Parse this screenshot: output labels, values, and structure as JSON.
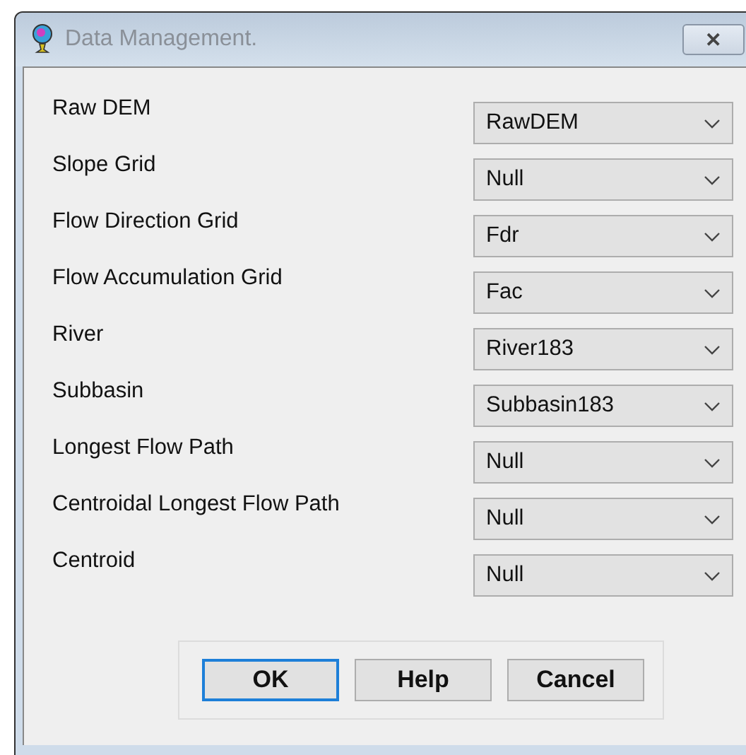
{
  "window": {
    "title": "Data Management.",
    "close": "✕"
  },
  "fields": [
    {
      "label": "Raw DEM",
      "value": "RawDEM"
    },
    {
      "label": "Slope Grid",
      "value": "Null"
    },
    {
      "label": "Flow Direction Grid",
      "value": "Fdr"
    },
    {
      "label": "Flow Accumulation Grid",
      "value": "Fac"
    },
    {
      "label": "River",
      "value": "River183"
    },
    {
      "label": "Subbasin",
      "value": "Subbasin183"
    },
    {
      "label": "Longest Flow Path",
      "value": "Null"
    },
    {
      "label": "Centroidal Longest Flow Path",
      "value": "Null"
    },
    {
      "label": "Centroid",
      "value": "Null"
    }
  ],
  "buttons": [
    {
      "label": "OK",
      "focused": true
    },
    {
      "label": "Help",
      "focused": false
    },
    {
      "label": "Cancel",
      "focused": false
    }
  ]
}
